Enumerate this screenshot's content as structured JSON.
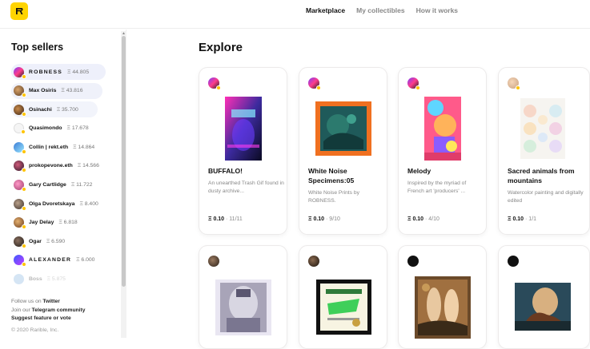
{
  "nav": {
    "items": [
      "Marketplace",
      "My collectibles",
      "How it works"
    ]
  },
  "sidebar": {
    "title": "Top sellers",
    "sellers": [
      {
        "name": "ROBNESS",
        "amount": "Ξ 44.805"
      },
      {
        "name": "Max Osiris",
        "amount": "Ξ 43.816"
      },
      {
        "name": "Osinachi",
        "amount": "Ξ 35.700"
      },
      {
        "name": "Quasimondo",
        "amount": "Ξ 17.678"
      },
      {
        "name": "Collin | rekt.eth",
        "amount": "Ξ 14.864"
      },
      {
        "name": "prokopevone.eth",
        "amount": "Ξ 14.566"
      },
      {
        "name": "Gary Cartlidge",
        "amount": "Ξ 11.722"
      },
      {
        "name": "Olga Dvoretskaya",
        "amount": "Ξ 8.400"
      },
      {
        "name": "Jay Delay",
        "amount": "Ξ 6.818"
      },
      {
        "name": "Ogar",
        "amount": "Ξ 6.590"
      },
      {
        "name": "ALEXANDER",
        "amount": "Ξ 6.000"
      },
      {
        "name": "Boss",
        "amount": "Ξ 5.875"
      }
    ],
    "footer": {
      "follow_prefix": "Follow us on ",
      "follow_link": "Twitter",
      "join_prefix": "Join our ",
      "join_link": "Telegram community",
      "suggest": "Suggest feature or vote",
      "copyright": "© 2020 Rarible, Inc."
    }
  },
  "main": {
    "title": "Explore",
    "cards": [
      {
        "title": "BUFFALO!",
        "desc": "An unearthed Trash Gif found in dusty archive...",
        "price": "Ξ 0.10",
        "edition": "· 11/11"
      },
      {
        "title": "White Noise Specimens:05",
        "desc": "White Noise Prints by ROBNESS.",
        "price": "Ξ 0.10",
        "edition": "· 9/10"
      },
      {
        "title": "Melody",
        "desc": "Inspired by the myriad of French art 'producers' ...",
        "price": "Ξ 0.10",
        "edition": "· 4/10"
      },
      {
        "title": "Sacred animals from mountains",
        "desc": "Watercolor painting and digitally edited",
        "price": "Ξ 0.10",
        "edition": "· 1/1"
      },
      {
        "title": "",
        "desc": "",
        "price": "",
        "edition": ""
      },
      {
        "title": "",
        "desc": "",
        "price": "",
        "edition": ""
      },
      {
        "title": "",
        "desc": "",
        "price": "",
        "edition": ""
      },
      {
        "title": "",
        "desc": "",
        "price": "",
        "edition": ""
      }
    ]
  },
  "colors": {
    "brand": "#ffd400",
    "verified": "#ffc400"
  }
}
